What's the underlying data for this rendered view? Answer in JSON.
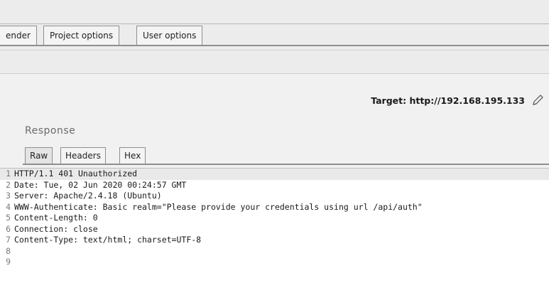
{
  "tabs": [
    {
      "label": "ender"
    },
    {
      "label": "Project options"
    },
    {
      "label": "User options"
    }
  ],
  "target": {
    "label": "Target: http://192.168.195.133"
  },
  "response": {
    "title": "Response",
    "tabs": [
      "Raw",
      "Headers",
      "Hex"
    ],
    "active_tab": "Raw"
  },
  "lines": [
    {
      "num": "1",
      "text": "HTTP/1.1 401 Unauthorized"
    },
    {
      "num": "2",
      "text": "Date: Tue, 02 Jun 2020 00:24:57 GMT"
    },
    {
      "num": "3",
      "text": "Server: Apache/2.4.18 (Ubuntu)"
    },
    {
      "num": "4",
      "text": "WWW-Authenticate: Basic realm=\"Please provide your credentials using url /api/auth\""
    },
    {
      "num": "5",
      "text": "Content-Length: 0"
    },
    {
      "num": "6",
      "text": "Connection: close"
    },
    {
      "num": "7",
      "text": "Content-Type: text/html; charset=UTF-8"
    },
    {
      "num": "8",
      "text": ""
    },
    {
      "num": "9",
      "text": ""
    }
  ],
  "icons": {
    "edit": "pencil-icon"
  }
}
